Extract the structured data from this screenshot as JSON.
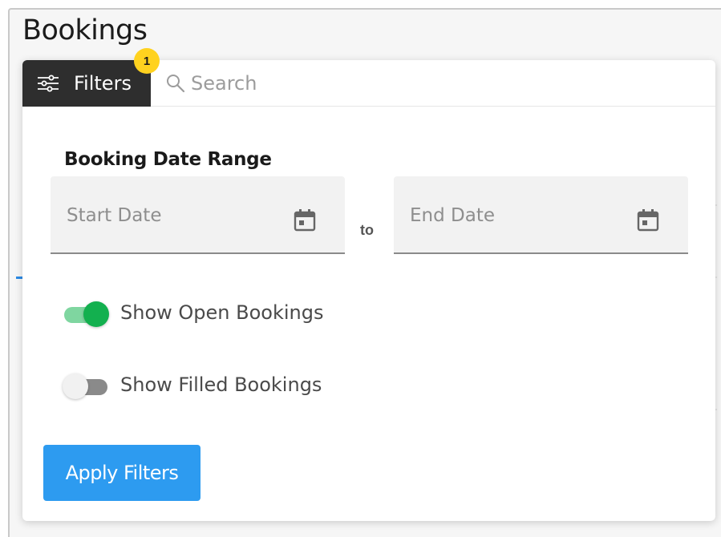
{
  "header": {
    "title": "Bookings"
  },
  "toolbar": {
    "filters_label": "Filters",
    "filters_badge": "1",
    "search_placeholder": "Search"
  },
  "filter_panel": {
    "date_range": {
      "title": "Booking Date Range",
      "start_placeholder": "Start Date",
      "separator": "to",
      "end_placeholder": "End Date"
    },
    "toggles": [
      {
        "label": "Show Open Bookings",
        "checked": true
      },
      {
        "label": "Show Filled Bookings",
        "checked": false
      }
    ],
    "apply_label": "Apply Filters"
  },
  "colors": {
    "accent": "#2d9bf0",
    "toggle_on": "#13b04f",
    "badge": "#ffd21f",
    "tab_dark": "#2e2e2e"
  }
}
